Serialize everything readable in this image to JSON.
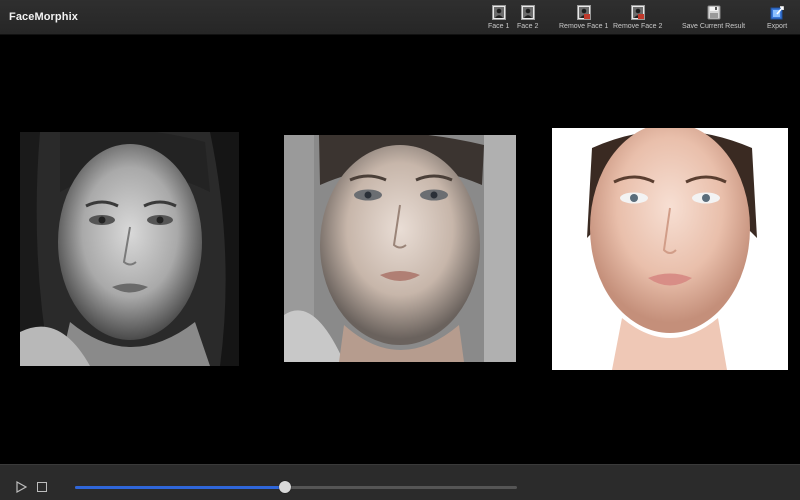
{
  "app": {
    "title": "FaceMorphix"
  },
  "toolbar": {
    "buttons": [
      {
        "label": "Face 1",
        "icon": "portrait-icon"
      },
      {
        "label": "Face 2",
        "icon": "portrait-icon"
      },
      {
        "label": "Remove Face 1",
        "icon": "remove-portrait-icon"
      },
      {
        "label": "Remove Face 2",
        "icon": "remove-portrait-icon"
      },
      {
        "label": "Save Current Result",
        "icon": "floppy-disk-icon"
      },
      {
        "label": "Export",
        "icon": "export-icon"
      }
    ]
  },
  "images": {
    "face1": {
      "description_icon": "face-photo-grayscale"
    },
    "morph": {
      "description_icon": "face-photo-morphed"
    },
    "face2": {
      "description_icon": "face-photo-color"
    }
  },
  "playback": {
    "play_icon": "play-icon",
    "stop_icon": "stop-icon",
    "progress": 0.475
  },
  "colors": {
    "toolbar_bg": "#2b2b2b",
    "accent": "#2f66d9",
    "remove_accent": "#c0392b",
    "background": "#000000"
  }
}
